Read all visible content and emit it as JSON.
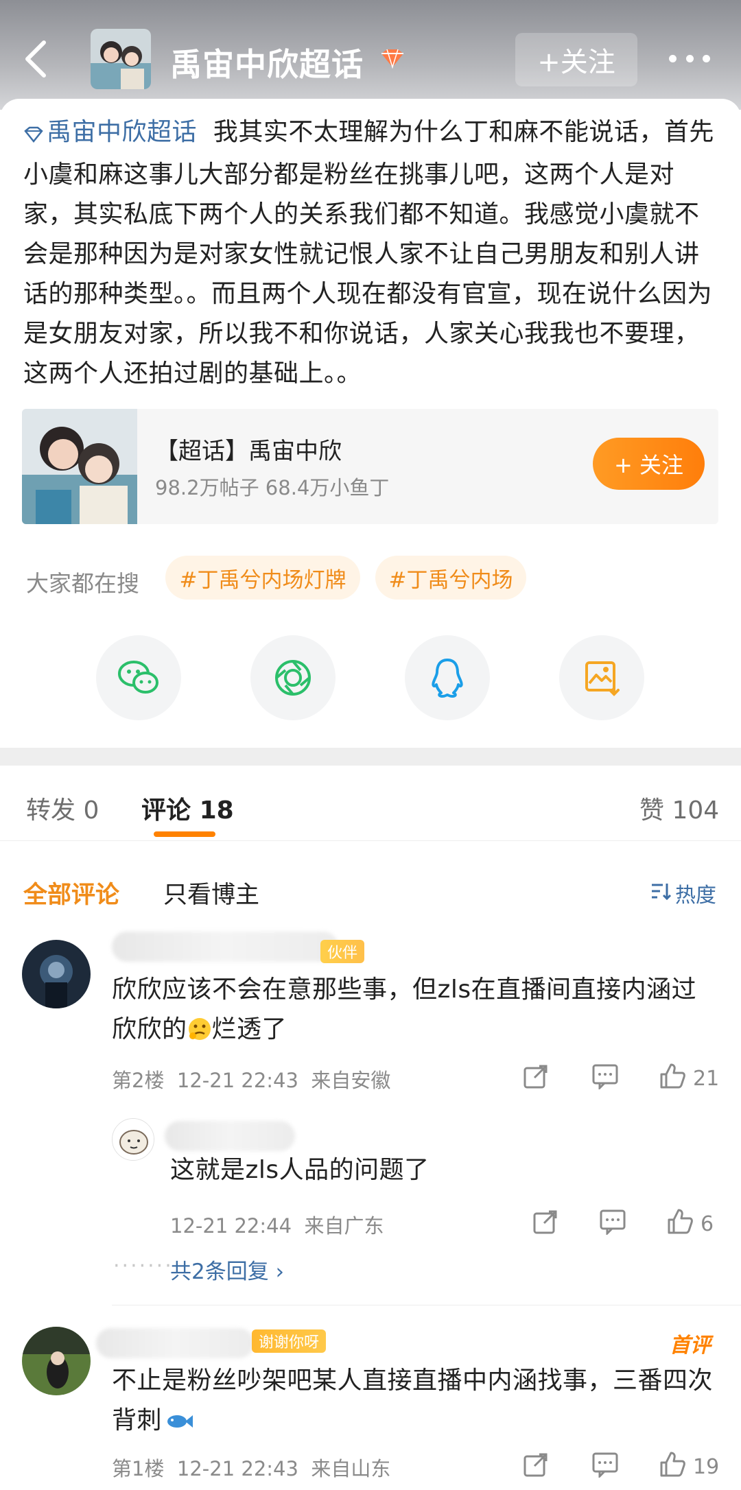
{
  "header": {
    "title": "禹宙中欣超话",
    "follow_label": "+关注"
  },
  "post": {
    "topic": "禹宙中欣超话",
    "text": "我其实不太理解为什么丁和麻不能说话，首先小虞和麻这事儿大部分都是粉丝在挑事儿吧，这两个人是对家，其实私底下两个人的关系我们都不知道。我感觉小虞就不会是那种因为是对家女性就记恨人家不让自己男朋友和别人讲话的那种类型。。而且两个人现在都没有官宣，现在说什么因为是女朋友对家，所以我不和你说话，人家关心我我也不要理，这两个人还拍过剧的基础上。。"
  },
  "supertopic": {
    "name": "【超话】禹宙中欣",
    "stats": "98.2万帖子 68.4万小鱼丁",
    "follow_label": "+ 关注"
  },
  "search": {
    "label": "大家都在搜",
    "tags": [
      "#丁禹兮内场灯牌",
      "#丁禹兮内场"
    ]
  },
  "share_icons": [
    "wechat-icon",
    "moments-icon",
    "qq-icon",
    "save-image-icon"
  ],
  "tabs": {
    "repost_label": "转发",
    "repost_count": "0",
    "comment_label": "评论",
    "comment_count": "18",
    "like_label": "赞",
    "like_count": "104"
  },
  "filters": {
    "all": "全部评论",
    "host_only": "只看博主",
    "sort": "热度"
  },
  "comments": [
    {
      "badge": "伙伴",
      "text": "欣欣应该不会在意那些事，但zls在直播间直接内涵过欣欣的",
      "text_tail": "烂透了",
      "floor": "第2楼",
      "time": "12-21 22:43",
      "location": "来自安徽",
      "likes": "21",
      "reply": {
        "text": "这就是zls人品的问题了",
        "time": "12-21 22:44",
        "location": "来自广东",
        "likes": "6"
      },
      "more_replies": "共2条回复"
    },
    {
      "badge": "谢谢你呀",
      "hot_label": "首评",
      "text": "不止是粉丝吵架吧某人直接直播中内涵找事，三番四次背刺",
      "floor": "第1楼",
      "time": "12-21 22:43",
      "location": "来自山东",
      "likes": "19"
    }
  ],
  "colors": {
    "accent": "#ff8200",
    "link": "#3d6ea5",
    "muted": "#8a8a8a"
  }
}
